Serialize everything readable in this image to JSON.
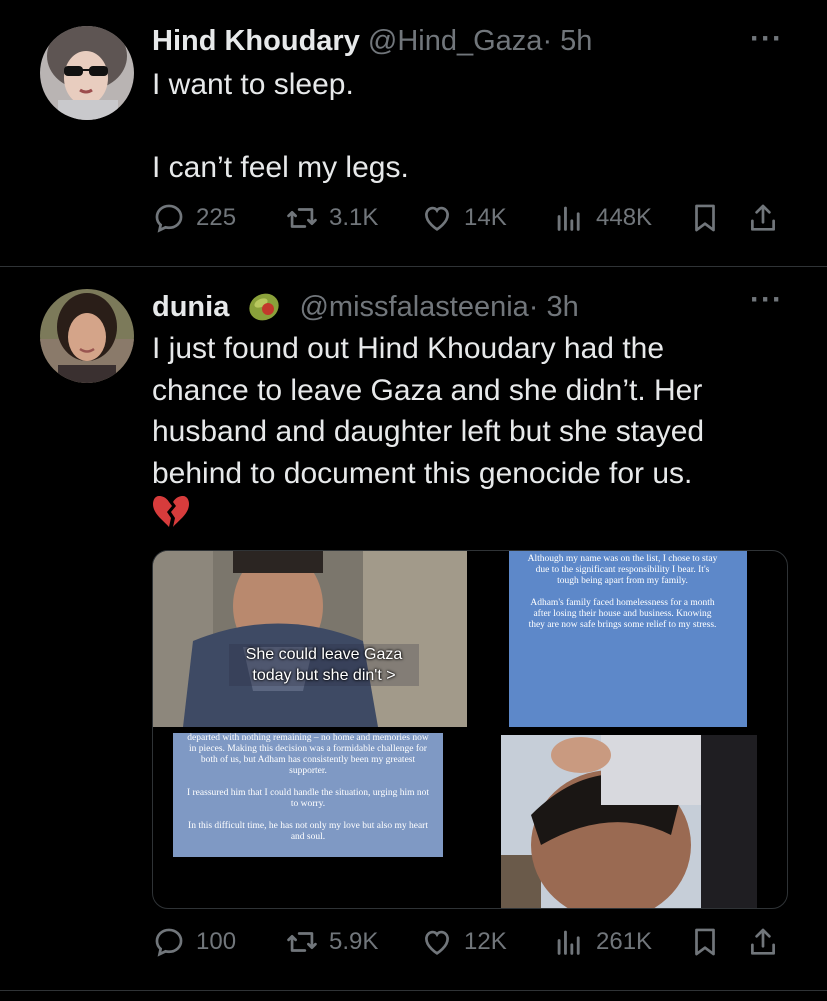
{
  "tweets": [
    {
      "author_name": "Hind Khoudary",
      "author_handle": "@Hind_Gaza",
      "time": "· 5h",
      "text": "I want to sleep.\n\nI can’t feel my legs.",
      "stats": {
        "replies": "225",
        "reposts": "3.1K",
        "likes": "14K",
        "views": "448K"
      }
    },
    {
      "author_name": "dunia",
      "author_handle": "@missfalasteenia",
      "time": "· 3h",
      "badge_emoji": "olive-icon",
      "text": "I just found out Hind Khoudary had the\nchance to leave Gaza and she didn’t. Her\nhusband and daughter left but she stayed\nbehind to document this genocide for us.",
      "trailing_emoji": "broken-heart-icon",
      "media": {
        "video_caption_1": "She could leave Gaza",
        "video_caption_2": "today but she din't",
        "note_top": "Although my name was on the list, I chose to stay due to the significant responsibility I bear. It's tough being apart from my family.\n\nAdham's family faced homelessness for a month after losing their house and business. Knowing they are now safe brings some relief to my stress.",
        "note_bottom": "departed with nothing remaining – no home and memories now in pieces. Making this decision was a formidable challenge for both of us, but Adham has consistently been my greatest supporter.\n\nI reassured him that I could handle the situation, urging him not to worry.\n\nIn this difficult time, he has not only my love but also my heart and soul."
      },
      "stats": {
        "replies": "100",
        "reposts": "5.9K",
        "likes": "12K",
        "views": "261K"
      }
    }
  ],
  "colors": {
    "background": "#000000",
    "text": "#e7e9ea",
    "muted": "#71767b",
    "divider": "#2f3336"
  }
}
